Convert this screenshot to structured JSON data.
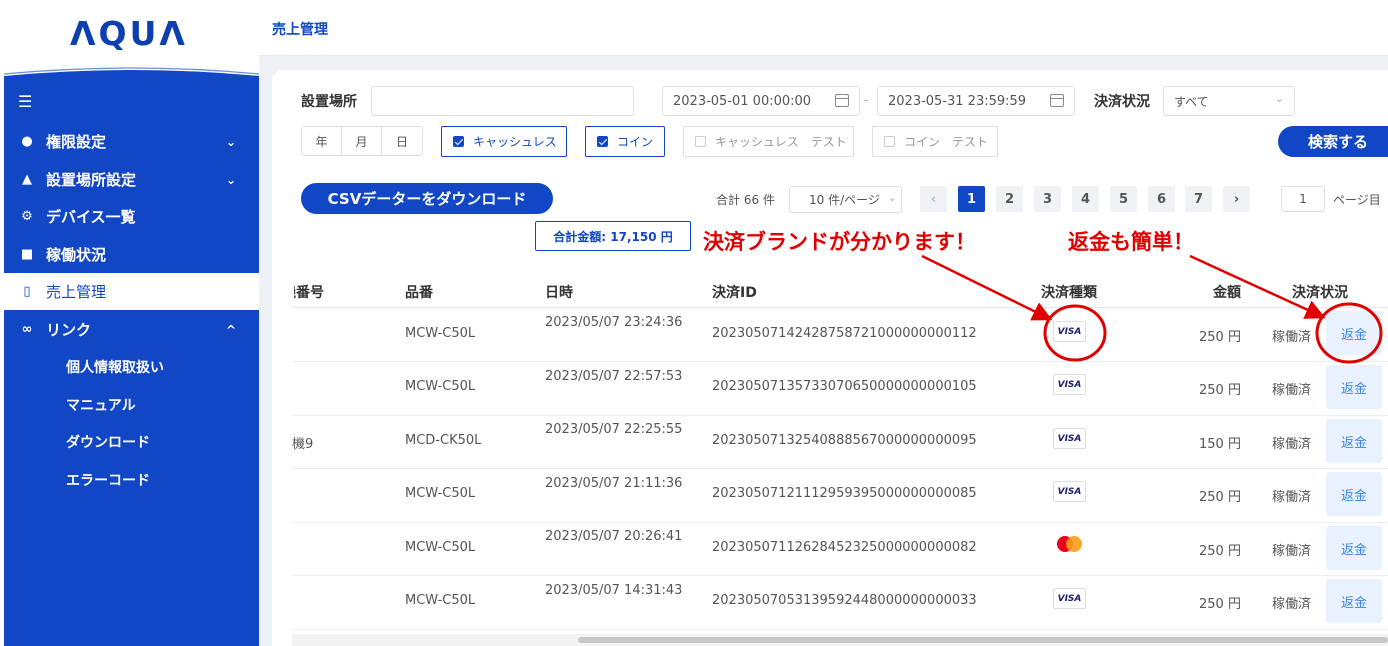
{
  "brand": {
    "logo": "ΛQUΛ"
  },
  "sidebar": {
    "items": [
      {
        "label": "権限設定",
        "icon": "user-icon",
        "chevron": "⌄"
      },
      {
        "label": "設置場所設定",
        "icon": "home-icon",
        "chevron": "⌄"
      },
      {
        "label": "デバイス一覧",
        "icon": "gear-icon"
      },
      {
        "label": "稼働状況",
        "icon": "grid-icon"
      },
      {
        "label": "売上管理",
        "icon": "document-icon"
      },
      {
        "label": "リンク",
        "icon": "link-icon",
        "chevron": "^"
      }
    ],
    "subitems": [
      {
        "label": "個人情報取扱い"
      },
      {
        "label": "マニュアル"
      },
      {
        "label": "ダウンロード"
      },
      {
        "label": "エラーコード"
      }
    ]
  },
  "header": {
    "title": "売上管理"
  },
  "filters": {
    "location_label": "設置場所",
    "location_value": "",
    "date_from": "2023-05-01 00:00:00",
    "date_sep": "-",
    "date_to": "2023-05-31 23:59:59",
    "status_label": "決済状況",
    "status_value": "すべて",
    "segments": [
      "年",
      "月",
      "日"
    ],
    "checks": [
      {
        "label": "キャッシュレス",
        "checked": true
      },
      {
        "label": "コイン",
        "checked": true
      },
      {
        "label": "キャッシュレス　テスト",
        "checked": false
      },
      {
        "label": "コイン　テスト",
        "checked": false
      }
    ],
    "search_label": "検索する"
  },
  "toolbar": {
    "csv_label": "CSVデーターをダウンロード",
    "total_count": "合計 66 件",
    "page_size": "10 件/ページ",
    "prev": "‹",
    "next": "›",
    "pages": [
      "1",
      "2",
      "3",
      "4",
      "5",
      "6",
      "7"
    ],
    "active_page": "1",
    "jump_value": "1",
    "jump_label": "ページ目",
    "total_amount": "合計金額: 17,150 円"
  },
  "table": {
    "headers": [
      "機番号",
      "品番",
      "日時",
      "決済ID",
      "決済種類",
      "金額",
      "決済状況"
    ],
    "rows": [
      {
        "machine": "",
        "product": "MCW-C50L",
        "datetime": "2023/05/07 23:24:36",
        "payment_id": "20230507142428758721000000000112",
        "brand": "VISA",
        "amount": "250 円",
        "status": "稼働済",
        "action": "返金"
      },
      {
        "machine": "",
        "product": "MCW-C50L",
        "datetime": "2023/05/07 22:57:53",
        "payment_id": "20230507135733070650000000000105",
        "brand": "VISA",
        "amount": "250 円",
        "status": "稼働済",
        "action": "返金"
      },
      {
        "machine": "機9",
        "product": "MCD-CK50L",
        "datetime": "2023/05/07 22:25:55",
        "payment_id": "20230507132540888567000000000095",
        "brand": "VISA",
        "amount": "150 円",
        "status": "稼働済",
        "action": "返金"
      },
      {
        "machine": "",
        "product": "MCW-C50L",
        "datetime": "2023/05/07 21:11:36",
        "payment_id": "20230507121112959395000000000085",
        "brand": "VISA",
        "amount": "250 円",
        "status": "稼働済",
        "action": "返金"
      },
      {
        "machine": "",
        "product": "MCW-C50L",
        "datetime": "2023/05/07 20:26:41",
        "payment_id": "20230507112628452325000000000082",
        "brand": "Mastercard",
        "amount": "250 円",
        "status": "稼働済",
        "action": "返金"
      },
      {
        "machine": "",
        "product": "MCW-C50L",
        "datetime": "2023/05/07 14:31:43",
        "payment_id": "20230507053139592448000000000033",
        "brand": "VISA",
        "amount": "250 円",
        "status": "稼働済",
        "action": "返金"
      }
    ]
  },
  "annotations": {
    "brand_note": "決済ブランドが分かります！",
    "refund_note": "返金も簡単！",
    "color": "#e00000"
  },
  "colors": {
    "primary": "#1147c5",
    "refund_bg": "#e8f1fd",
    "refund_text": "#3a86e8"
  }
}
